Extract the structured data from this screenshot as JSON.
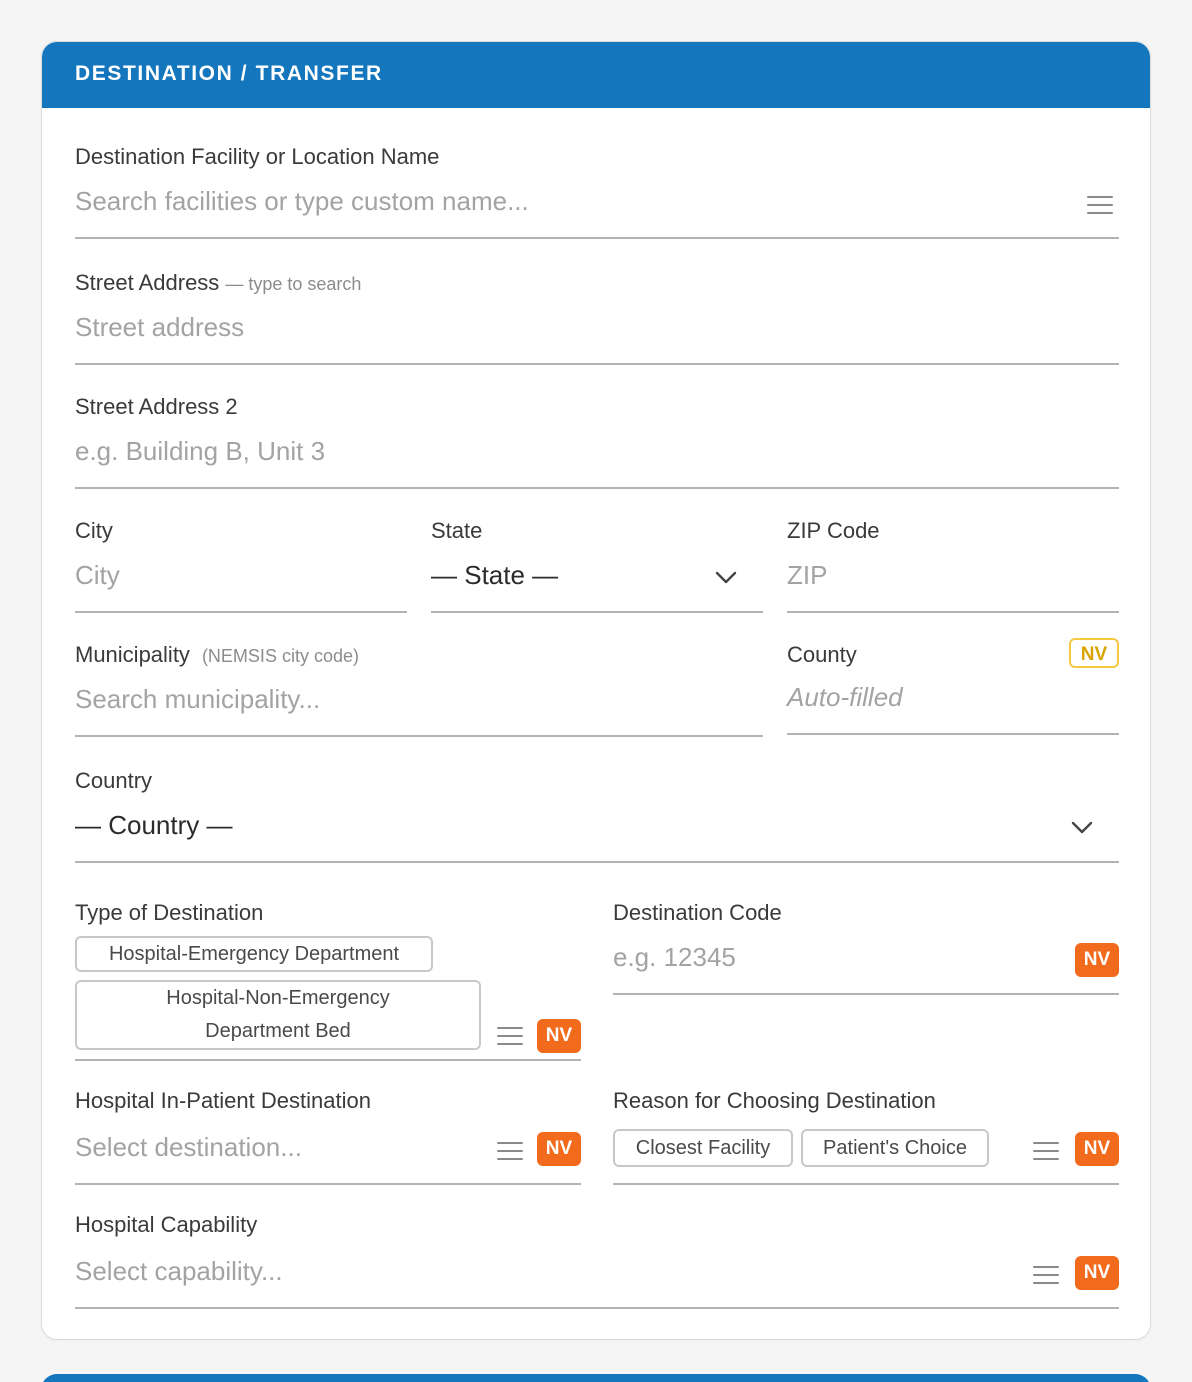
{
  "section": {
    "title": "DESTINATION / TRANSFER"
  },
  "facility": {
    "label": "Destination Facility or Location Name",
    "placeholder": "Search facilities or type custom name..."
  },
  "street": {
    "label": "Street Address",
    "hint": "— type to search",
    "placeholder": "Street address"
  },
  "street2": {
    "label": "Street Address 2",
    "placeholder": "e.g. Building B, Unit 3"
  },
  "city": {
    "label": "City",
    "placeholder": "City"
  },
  "state": {
    "label": "State",
    "value": "— State —"
  },
  "zip": {
    "label": "ZIP Code",
    "placeholder": "ZIP"
  },
  "municipality": {
    "label": "Municipality",
    "hint": "(NEMSIS city code)",
    "placeholder": "Search municipality..."
  },
  "county": {
    "label": "County",
    "badge": "NV",
    "placeholder": "Auto-filled"
  },
  "country": {
    "label": "Country",
    "value": "— Country —"
  },
  "destination_type": {
    "label": "Type of Destination",
    "chips": [
      "Hospital-Emergency Department",
      "Hospital-Non-Emergency",
      "Department Bed"
    ],
    "badge": "NV"
  },
  "destination_code": {
    "label": "Destination Code",
    "placeholder": "e.g. 12345",
    "badge": "NV"
  },
  "inpatient": {
    "label": "Hospital In-Patient Destination",
    "placeholder": "Select destination...",
    "badge": "NV"
  },
  "reason": {
    "label": "Reason for Choosing Destination",
    "chips": [
      "Closest Facility",
      "Patient's Choice"
    ],
    "badge": "NV"
  },
  "capability": {
    "label": "Hospital Capability",
    "placeholder": "Select capability...",
    "badge": "NV"
  },
  "colors": {
    "header": "#1477bd",
    "nv_solid": "#f26b1d",
    "nv_outline": "#f5c842"
  }
}
